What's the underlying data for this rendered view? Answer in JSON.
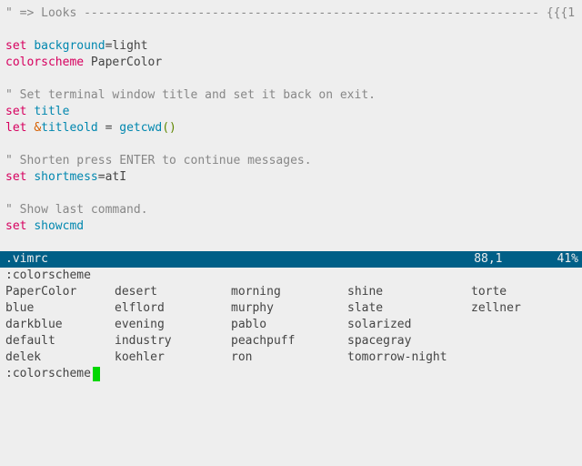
{
  "editor": {
    "lines": [
      {
        "type": "comment",
        "text": "\" => Looks ---------------------------------------------------------------- {{{1"
      },
      {
        "type": "blank"
      },
      {
        "segments": [
          {
            "cls": "keyword",
            "text": "set"
          },
          {
            "cls": "",
            "text": " "
          },
          {
            "cls": "option",
            "text": "background"
          },
          {
            "cls": "",
            "text": "=light"
          }
        ]
      },
      {
        "segments": [
          {
            "cls": "keyword",
            "text": "colorscheme"
          },
          {
            "cls": "",
            "text": " PaperColor"
          }
        ]
      },
      {
        "type": "blank"
      },
      {
        "type": "comment",
        "text": "\" Set terminal window title and set it back on exit."
      },
      {
        "segments": [
          {
            "cls": "keyword",
            "text": "set"
          },
          {
            "cls": "",
            "text": " "
          },
          {
            "cls": "option",
            "text": "title"
          }
        ]
      },
      {
        "segments": [
          {
            "cls": "keyword",
            "text": "let"
          },
          {
            "cls": "",
            "text": " "
          },
          {
            "cls": "special",
            "text": "&"
          },
          {
            "cls": "option",
            "text": "titleold"
          },
          {
            "cls": "",
            "text": " = "
          },
          {
            "cls": "func",
            "text": "getcwd"
          },
          {
            "cls": "paren",
            "text": "()"
          }
        ]
      },
      {
        "type": "blank"
      },
      {
        "type": "comment",
        "text": "\" Shorten press ENTER to continue messages."
      },
      {
        "segments": [
          {
            "cls": "keyword",
            "text": "set"
          },
          {
            "cls": "",
            "text": " "
          },
          {
            "cls": "option",
            "text": "shortmess"
          },
          {
            "cls": "",
            "text": "=atI"
          }
        ]
      },
      {
        "type": "blank"
      },
      {
        "type": "comment",
        "text": "\" Show last command."
      },
      {
        "segments": [
          {
            "cls": "keyword",
            "text": "set"
          },
          {
            "cls": "",
            "text": " "
          },
          {
            "cls": "option",
            "text": "showcmd"
          }
        ]
      },
      {
        "type": "blank"
      }
    ]
  },
  "status": {
    "filename": ".vimrc",
    "position": "88,1",
    "percent": "41%"
  },
  "completion": {
    "header": ":colorscheme",
    "grid": [
      [
        "PaperColor",
        "desert",
        "morning",
        "shine",
        "torte"
      ],
      [
        "blue",
        "elflord",
        "murphy",
        "slate",
        "zellner"
      ],
      [
        "darkblue",
        "evening",
        "pablo",
        "solarized",
        ""
      ],
      [
        "default",
        "industry",
        "peachpuff",
        "spacegray",
        ""
      ],
      [
        "delek",
        "koehler",
        "ron",
        "tomorrow-night",
        ""
      ]
    ]
  },
  "cmdline": {
    "text": ":colorscheme "
  }
}
